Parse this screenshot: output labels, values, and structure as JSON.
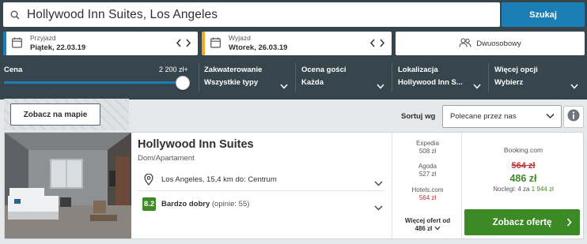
{
  "search": {
    "query": "Hollywood Inn Suites, Los Angeles",
    "button_label": "Szukaj",
    "icon": "search-icon"
  },
  "dates": {
    "checkin": {
      "label": "Przyjazd",
      "value": "Piątek, 22.03.19",
      "accent": "#1b7fb5"
    },
    "checkout": {
      "label": "Wyjazd",
      "value": "Wtorek, 26.03.19",
      "accent": "#f5a623"
    }
  },
  "rooms": {
    "label": "Dwuosobowy",
    "icon": "two-persons-icon"
  },
  "filters": {
    "price": {
      "label": "Cena",
      "max_value": "2 200 zł+",
      "slider_fraction": 1.0
    },
    "accommodation": {
      "label": "Zakwaterowanie",
      "value": "Wszystkie typy"
    },
    "rating": {
      "label": "Ocena gości",
      "value": "Każda"
    },
    "location": {
      "label": "Lokalizacja",
      "value": "Hollywood Inn S..."
    },
    "more": {
      "label": "Więcej opcji",
      "value": "Wybierz"
    }
  },
  "toolbar": {
    "map_button": "Zobacz na mapie",
    "sort_label": "Sortuj wg",
    "sort_value": "Polecane przez nas"
  },
  "result": {
    "name": "Hollywood Inn Suites",
    "type": "Dom/Apartament",
    "location": "Los Angeles, 15,4 km do: Centrum",
    "rating_score": "8.2",
    "rating_label": "Bardzo dobry",
    "rating_count": "(opinie: 55)",
    "deals": [
      {
        "site": "Expedia",
        "price": "508 zł",
        "highlight": false
      },
      {
        "site": "Agoda",
        "price": "527 zł",
        "highlight": false
      },
      {
        "site": "Hotels.com",
        "price": "564 zł",
        "highlight": true
      }
    ],
    "more_deals_line1": "Więcej ofert od",
    "more_deals_line2": "486 zł",
    "best_offer": {
      "site": "Booking.com",
      "old_price": "564 zł",
      "price": "486 zł",
      "nights_prefix": "Noclegi: 4 za",
      "nights_total": "1 944 zł",
      "button_label": "Zobacz ofertę"
    }
  },
  "colors": {
    "header_bg": "#37454d",
    "primary_blue": "#1b7fb5",
    "checkout_orange": "#f5a623",
    "green": "#3b8a25",
    "red": "#c2312c"
  }
}
